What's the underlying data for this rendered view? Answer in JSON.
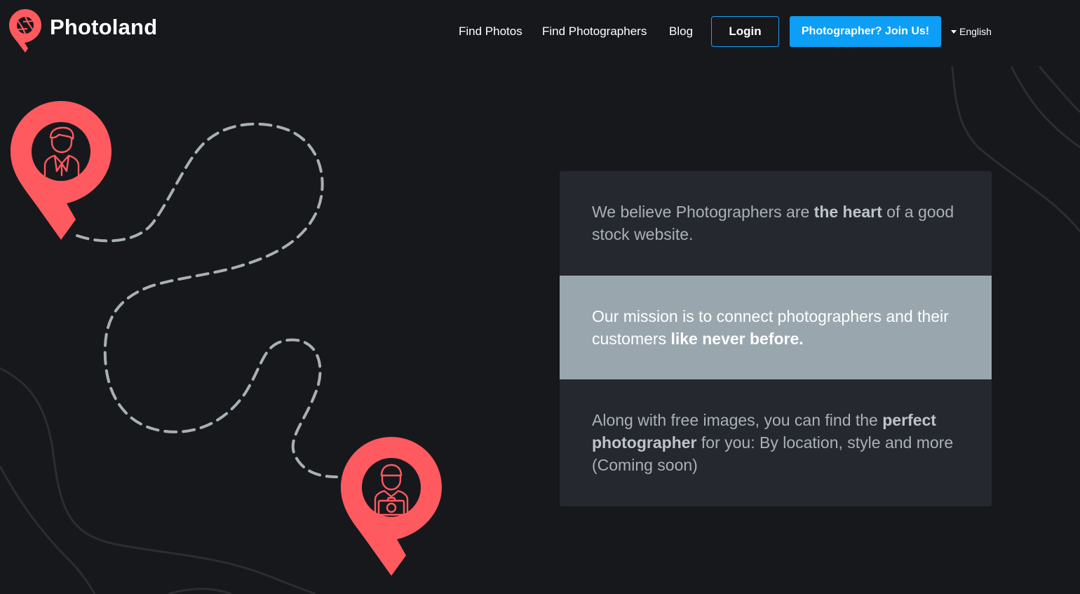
{
  "brand": {
    "name": "Photoland",
    "accent_color": "#ff5a5f",
    "logo_icon": "location-pin-aperture-icon"
  },
  "nav": {
    "links": [
      {
        "label": "Find Photos"
      },
      {
        "label": "Find Photographers"
      },
      {
        "label": "Blog"
      }
    ],
    "login_label": "Login",
    "join_label": "Photographer? Join Us!",
    "language": "English",
    "login_border_color": "#1aa0f3",
    "join_color": "#0d9ef5"
  },
  "illustration": {
    "top_pin_icon": "customer-avatar-icon",
    "bottom_pin_icon": "photographer-camera-icon"
  },
  "cards": [
    {
      "text_before": "We believe Photographers are ",
      "bold": "the heart",
      "text_after": " of a good stock website."
    },
    {
      "text_before": "Our mission is to connect photographers and their customers ",
      "bold": "like never before.",
      "text_after": ""
    },
    {
      "text_before": "Along with free images, you can find the ",
      "bold": "perfect photographer",
      "text_after": " for you: By location, style and more (Coming soon)"
    }
  ]
}
